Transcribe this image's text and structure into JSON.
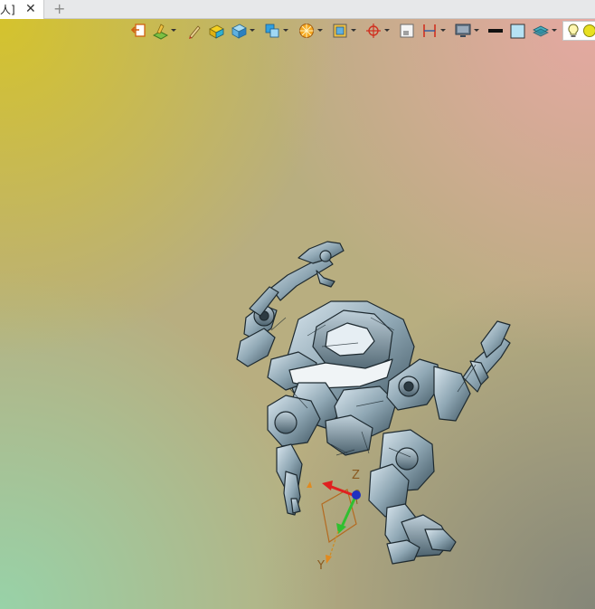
{
  "tabs": [
    {
      "label": "器人]",
      "active": true
    }
  ],
  "tab_close_glyph": "✕",
  "tab_add_glyph": "+",
  "toolbar": {
    "tools": [
      {
        "name": "exit-sketch-icon",
        "has_dropdown": false
      },
      {
        "name": "sketch-plane-icon",
        "has_dropdown": true
      },
      {
        "name": "pen-icon",
        "has_dropdown": false
      },
      {
        "name": "block-icon",
        "has_dropdown": false
      },
      {
        "name": "solid-view-icon",
        "has_dropdown": true
      },
      {
        "name": "orient-view-icon",
        "has_dropdown": true
      },
      {
        "name": "render-style-icon",
        "has_dropdown": true
      },
      {
        "name": "section-view-icon",
        "has_dropdown": true
      },
      {
        "name": "snap-point-icon",
        "has_dropdown": true
      },
      {
        "name": "clip-box-icon",
        "has_dropdown": false
      },
      {
        "name": "measure-icon",
        "has_dropdown": true
      },
      {
        "name": "display-monitor-icon",
        "has_dropdown": true
      },
      {
        "name": "line-color-icon",
        "has_dropdown": false
      },
      {
        "name": "background-color-icon",
        "has_dropdown": false
      },
      {
        "name": "layer-icon",
        "has_dropdown": true
      },
      {
        "name": "lightbulb-icon",
        "has_dropdown": false
      },
      {
        "name": "light-source-icon",
        "has_dropdown": false
      }
    ]
  },
  "triad": {
    "z_label": "Z",
    "y_label": "Y",
    "x_color": "#e02020",
    "y_color": "#30c030",
    "z_color": "#2030c0"
  },
  "colors": {
    "accent_orange": "#e08a20",
    "model_steel": "#8fa7b4"
  }
}
